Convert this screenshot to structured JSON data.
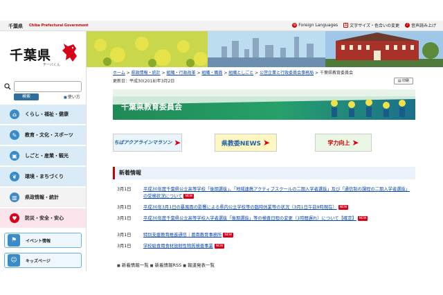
{
  "topbar": {
    "pref_name": "千葉県",
    "pref_name_en": "Chiba Prefectural Government",
    "links": [
      "Foreign Languages",
      "文字サイズ・色合いの変更",
      "音声読み上げ"
    ]
  },
  "logo": {
    "text": "千葉県",
    "sub": "チーバくん"
  },
  "search": {
    "placeholder": "",
    "button": "検索",
    "howto": "使い方"
  },
  "nav": {
    "items": [
      {
        "label": "くらし・福祉・健康",
        "icon": "house-icon",
        "color": "#3b8bc9"
      },
      {
        "label": "教育・文化・スポーツ",
        "icon": "pencil-icon",
        "color": "#3b8bc9"
      },
      {
        "label": "しごと・産業・観光",
        "icon": "briefcase-icon",
        "color": "#3b8bc9"
      },
      {
        "label": "環境・まちづくり",
        "icon": "leaf-icon",
        "color": "#3b8bc9"
      },
      {
        "label": "県政情報・統計",
        "icon": "building-icon",
        "color": "#3b8bc9"
      },
      {
        "label": "防災・安全・安心",
        "icon": "heart-icon",
        "color": "#d9001b"
      }
    ],
    "buttons": [
      {
        "label": "イベント情報",
        "icon": "flag-icon"
      },
      {
        "label": "キッズページ",
        "icon": "kids-icon"
      }
    ]
  },
  "breadcrumb": [
    "ホーム",
    "県政情報・統計",
    "組織・行政改革",
    "組織・職員",
    "組織としごと",
    "公営企業と行政委員会事務局",
    "千葉県教育委員会"
  ],
  "updated": "更新日：平成30(2018)年3月2日",
  "print": "印刷",
  "banner_title": "千葉県教育委員会",
  "banners": [
    {
      "label": "ちばアクアラインマラソン"
    },
    {
      "label": "県教委NEWS"
    },
    {
      "label": "学力向上"
    }
  ],
  "news": {
    "title": "新着情報",
    "new_label": "NEW",
    "items": [
      {
        "date": "3月1日",
        "text": "平成30年度千葉県公立高等学校「後期選抜」、「地域連携アクティブスクールの二期入学者選抜」及び「通信制の課程の二期入学者選抜」の受検状況について",
        "new": true
      },
      {
        "date": "3月1日",
        "text": "平成30年3月1日の暴風雨の影響による県内公立学校等の臨時休業等の状況（3月1日午前9時現在）",
        "new": true
      },
      {
        "date": "3月1日",
        "text": "平成30年度千葉県公立高等学校入学者選抜「後期選抜」等の検査日程の変更（1時間遅れ）について【確定】",
        "new": true
      },
      {
        "date": "3月1日",
        "text": "特別支援教育推進通信｜葛南教育事務所",
        "new": true
      },
      {
        "date": "3月1日",
        "text": "学校給食用食材放射性物質検査事業",
        "new": true
      }
    ]
  },
  "footer_links": [
    "新着情報一覧",
    "新着情報RSS",
    "報道発表一覧"
  ]
}
